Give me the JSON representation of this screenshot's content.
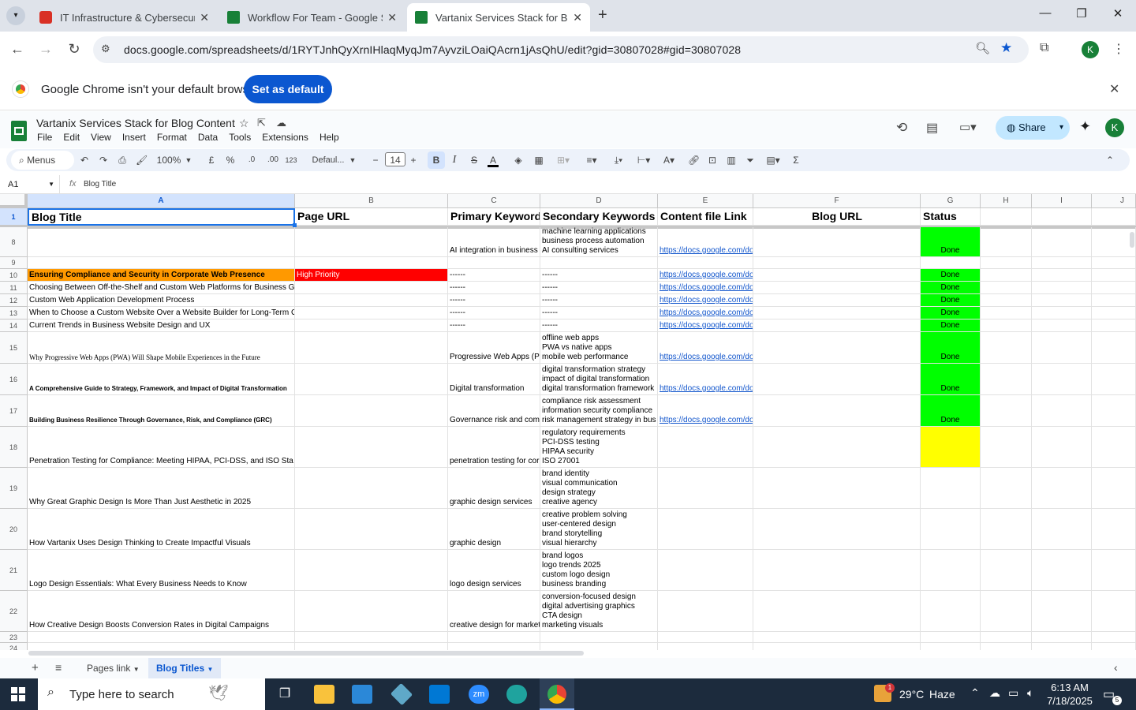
{
  "browser": {
    "tabs": [
      {
        "title": "IT Infrastructure & Cybersecurit",
        "color": "#d93025"
      },
      {
        "title": "Workflow For Team - Google Sh",
        "color": "#188038"
      },
      {
        "title": "Vartanix Services Stack for Blog",
        "color": "#188038"
      }
    ],
    "url": "docs.google.com/spreadsheets/d/1RYTJnhQyXrnIHlaqMyqJm7AyvziLOaiQAcrn1jAsQhU/edit?gid=30807028#gid=30807028",
    "profile_letter": "K",
    "infobar_text": "Google Chrome isn't your default browser",
    "infobar_button": "Set as default"
  },
  "doc": {
    "title": "Vartanix Services Stack for Blog Content",
    "menus": [
      "File",
      "Edit",
      "View",
      "Insert",
      "Format",
      "Data",
      "Tools",
      "Extensions",
      "Help"
    ],
    "share_label": "Share",
    "avatar": "K"
  },
  "toolbar": {
    "menus_label": "Menus",
    "zoom": "100%",
    "currency": "£",
    "percent": "%",
    "dec_less": ".0",
    "dec_more": ".00",
    "number_fmt": "123",
    "font": "Defaul...",
    "font_size": "14"
  },
  "formula": {
    "ref": "A1",
    "content": "Blog Title"
  },
  "columns": [
    "A",
    "B",
    "C",
    "D",
    "E",
    "F",
    "G",
    "H",
    "I",
    "J"
  ],
  "header_row": {
    "num": "1",
    "cells": [
      "Blog Title",
      "Page URL",
      "Primary Keyword",
      "Secondary Keywords",
      "Content file Link",
      "Blog URL",
      "Status"
    ]
  },
  "rows": [
    {
      "num": "8",
      "a": "",
      "b": "",
      "c": "AI integration in business",
      "d": "machine learning applications\nbusiness process automation\nAI consulting services",
      "e": "https://docs.google.com/do",
      "g": "Done"
    },
    {
      "num": "9",
      "a": "",
      "b": "",
      "c": "",
      "d": "",
      "e": "",
      "g": ""
    },
    {
      "num": "10",
      "a": "Ensuring Compliance and Security in Corporate Web Presence",
      "b": "High Priority",
      "c": "------",
      "d": "------",
      "e": "https://docs.google.com/do",
      "g": "Done"
    },
    {
      "num": "11",
      "a": "Choosing Between Off-the-Shelf and Custom Web Platforms for Business Growth",
      "b": "",
      "c": "------",
      "d": "------",
      "e": "https://docs.google.com/do",
      "g": "Done"
    },
    {
      "num": "12",
      "a": "Custom Web Application Development Process",
      "b": "",
      "c": "------",
      "d": "------",
      "e": "https://docs.google.com/do",
      "g": "Done"
    },
    {
      "num": "13",
      "a": "When to Choose a Custom Website Over a Website Builder for Long-Term Growth",
      "b": "",
      "c": "------",
      "d": "------",
      "e": "https://docs.google.com/do",
      "g": "Done"
    },
    {
      "num": "14",
      "a": "Current Trends in Business Website Design and UX",
      "b": "",
      "c": "------",
      "d": "------",
      "e": "https://docs.google.com/do",
      "g": "Done"
    },
    {
      "num": "15",
      "a": "Why Progressive Web Apps (PWA) Will Shape Mobile Experiences in the Future",
      "b": "",
      "c": "Progressive Web Apps (PWA",
      "d": "offline web apps\nPWA vs native apps\nmobile web performance",
      "e": "https://docs.google.com/do",
      "g": "Done"
    },
    {
      "num": "16",
      "a": "A Comprehensive Guide to Strategy, Framework, and Impact of Digital Transformation",
      "b": "",
      "c": "Digital transformation",
      "d": "digital transformation strategy\nimpact of digital transformation\ndigital transformation framework",
      "e": "https://docs.google.com/do",
      "g": "Done"
    },
    {
      "num": "17",
      "a": "Building Business Resilience Through Governance, Risk, and Compliance (GRC)",
      "b": "",
      "c": "Governance risk and com",
      "d": "compliance risk assessment\ninformation security compliance\nrisk management strategy in bus",
      "e": "https://docs.google.com/do",
      "g": "Done"
    },
    {
      "num": "18",
      "a": "Penetration Testing for Compliance: Meeting HIPAA, PCI-DSS, and ISO Sta",
      "b": "",
      "c": "penetration testing for cor",
      "d": "regulatory requirements\nPCI-DSS testing\nHIPAA security\nISO 27001",
      "e": "",
      "g": ""
    },
    {
      "num": "19",
      "a": "Why Great Graphic Design Is More Than Just Aesthetic in 2025",
      "b": "",
      "c": "graphic design services",
      "d": "brand identity\nvisual communication\ndesign strategy\ncreative agency",
      "e": "",
      "g": ""
    },
    {
      "num": "20",
      "a": "How Vartanix Uses Design Thinking to Create Impactful Visuals",
      "b": "",
      "c": "graphic design",
      "d": "creative problem solving\nuser-centered design\nbrand storytelling\nvisual hierarchy",
      "e": "",
      "g": ""
    },
    {
      "num": "21",
      "a": "Logo Design Essentials: What Every Business Needs to Know",
      "b": "",
      "c": "logo design services",
      "d": "brand logos\nlogo trends 2025\ncustom logo design\nbusiness branding",
      "e": "",
      "g": ""
    },
    {
      "num": "22",
      "a": "How Creative Design Boosts Conversion Rates in Digital Campaigns",
      "b": "",
      "c": "creative design for market",
      "d": "conversion-focused design\ndigital advertising graphics\nCTA design\nmarketing visuals",
      "e": "",
      "g": ""
    },
    {
      "num": "23",
      "a": "",
      "b": "",
      "c": "",
      "d": "",
      "e": "",
      "g": ""
    },
    {
      "num": "24",
      "a": "",
      "b": "",
      "c": "",
      "d": "",
      "e": "",
      "g": ""
    }
  ],
  "colors": {
    "done_green": "#00ff00",
    "yellow": "#ffff00",
    "orange": "#ff9900",
    "red": "#ff0000",
    "accent": "#0b57d0"
  },
  "sheet_tabs": [
    "Pages link",
    "Blog Titles"
  ],
  "taskbar": {
    "search_placeholder": "Type here to search",
    "temp": "29°C",
    "weather": "Haze",
    "time": "6:13 AM",
    "date": "7/18/2025",
    "notif": "5",
    "weather_badge": "1"
  }
}
